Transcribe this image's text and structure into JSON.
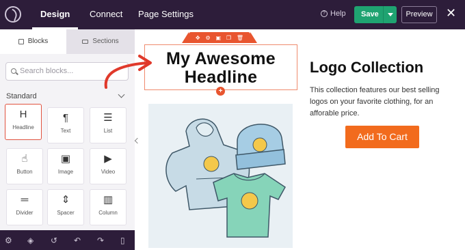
{
  "topbar": {
    "tabs": [
      {
        "label": "Design",
        "active": true
      },
      {
        "label": "Connect",
        "active": false
      },
      {
        "label": "Page Settings",
        "active": false
      }
    ],
    "help_label": "Help",
    "save_label": "Save",
    "preview_label": "Preview",
    "close_symbol": "✕"
  },
  "sidebar": {
    "tabs": [
      {
        "label": "Blocks",
        "icon": "blocks-icon"
      },
      {
        "label": "Sections",
        "icon": "sections-icon"
      }
    ],
    "search_placeholder": "Search blocks...",
    "section_label": "Standard",
    "blocks": [
      {
        "label": "Headline",
        "icon": "H",
        "selected": true
      },
      {
        "label": "Text",
        "icon": "¶",
        "selected": false
      },
      {
        "label": "List",
        "icon": "☰",
        "selected": false
      },
      {
        "label": "Button",
        "icon": "☝",
        "selected": false
      },
      {
        "label": "Image",
        "icon": "▣",
        "selected": false
      },
      {
        "label": "Video",
        "icon": "▶",
        "selected": false
      },
      {
        "label": "Divider",
        "icon": "═",
        "selected": false
      },
      {
        "label": "Spacer",
        "icon": "⇕",
        "selected": false
      },
      {
        "label": "Column",
        "icon": "▥",
        "selected": false
      }
    ]
  },
  "bottombar": {
    "icons": [
      "gear-icon",
      "layers-icon",
      "history-icon",
      "undo-icon",
      "redo-icon",
      "mobile-icon"
    ]
  },
  "canvas": {
    "headline": "My Awesome Headline",
    "headline_line1": "My Awesome",
    "headline_line2": "Headline",
    "product_title": "Logo Collection",
    "product_description": "This collection features our best selling logos on your favorite clothing, for an afforable price.",
    "cart_button": "Add To Cart"
  },
  "colors": {
    "topbar_bg": "#2d1d3a",
    "save_green": "#1fa371",
    "accent_orange": "#e8552f",
    "cart_orange": "#f26b1d",
    "annotation_red": "#e0392b"
  }
}
